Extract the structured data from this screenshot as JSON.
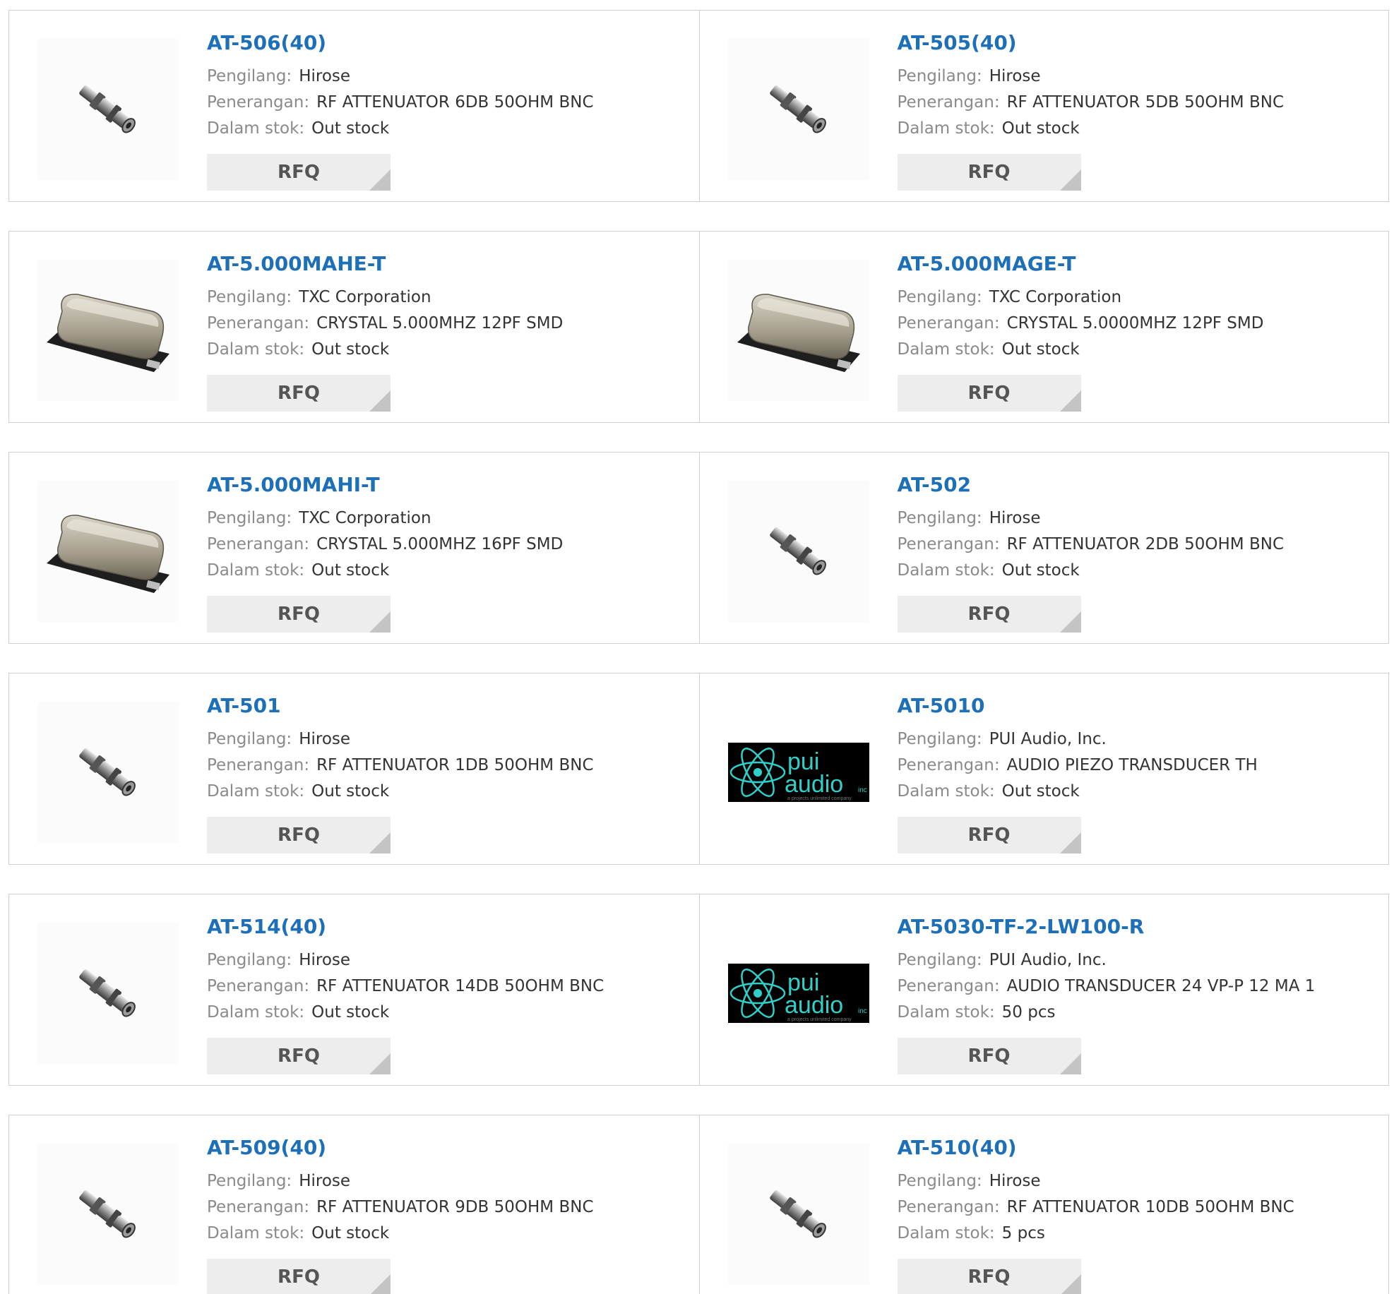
{
  "labels": {
    "manufacturer": "Pengilang:",
    "description": "Penerangan:",
    "stock": "Dalam stok:"
  },
  "colors": {
    "link": "#1d6fb8",
    "label": "#8a8a8a",
    "button_bg": "#ededed",
    "border": "#cfcfcf"
  },
  "products": [
    {
      "part": "AT-506(40)",
      "manufacturer": "Hirose",
      "description": "RF ATTENUATOR 6DB 50OHM BNC",
      "stock": "Out stock",
      "rfq": "RFQ",
      "image": "bnc-attenuator-icon"
    },
    {
      "part": "AT-505(40)",
      "manufacturer": "Hirose",
      "description": "RF ATTENUATOR 5DB 50OHM BNC",
      "stock": "Out stock",
      "rfq": "RFQ",
      "image": "bnc-attenuator-icon"
    },
    {
      "part": "AT-5.000MAHE-T",
      "manufacturer": "TXC Corporation",
      "description": "CRYSTAL 5.000MHZ 12PF SMD",
      "stock": "Out stock",
      "rfq": "RFQ",
      "image": "crystal-smd-icon"
    },
    {
      "part": "AT-5.000MAGE-T",
      "manufacturer": "TXC Corporation",
      "description": "CRYSTAL 5.0000MHZ 12PF SMD",
      "stock": "Out stock",
      "rfq": "RFQ",
      "image": "crystal-smd-icon"
    },
    {
      "part": "AT-5.000MAHI-T",
      "manufacturer": "TXC Corporation",
      "description": "CRYSTAL 5.000MHZ 16PF SMD",
      "stock": "Out stock",
      "rfq": "RFQ",
      "image": "crystal-smd-icon"
    },
    {
      "part": "AT-502",
      "manufacturer": "Hirose",
      "description": "RF ATTENUATOR 2DB 50OHM BNC",
      "stock": "Out stock",
      "rfq": "RFQ",
      "image": "bnc-attenuator-icon"
    },
    {
      "part": "AT-501",
      "manufacturer": "Hirose",
      "description": "RF ATTENUATOR 1DB 50OHM BNC",
      "stock": "Out stock",
      "rfq": "RFQ",
      "image": "bnc-attenuator-icon"
    },
    {
      "part": "AT-5010",
      "manufacturer": "PUI Audio, Inc.",
      "description": "AUDIO PIEZO TRANSDUCER TH",
      "stock": "Out stock",
      "rfq": "RFQ",
      "image": "pui-audio-logo"
    },
    {
      "part": "AT-514(40)",
      "manufacturer": "Hirose",
      "description": "RF ATTENUATOR 14DB 50OHM BNC",
      "stock": "Out stock",
      "rfq": "RFQ",
      "image": "bnc-attenuator-icon"
    },
    {
      "part": "AT-5030-TF-2-LW100-R",
      "manufacturer": "PUI Audio, Inc.",
      "description": "AUDIO TRANSDUCER 24 VP-P 12 MA 1",
      "stock": "50 pcs",
      "rfq": "RFQ",
      "image": "pui-audio-logo"
    },
    {
      "part": "AT-509(40)",
      "manufacturer": "Hirose",
      "description": "RF ATTENUATOR 9DB 50OHM BNC",
      "stock": "Out stock",
      "rfq": "RFQ",
      "image": "bnc-attenuator-icon"
    },
    {
      "part": "AT-510(40)",
      "manufacturer": "Hirose",
      "description": "RF ATTENUATOR 10DB 50OHM BNC",
      "stock": "5 pcs",
      "rfq": "RFQ",
      "image": "bnc-attenuator-icon"
    }
  ],
  "logo_text": {
    "word1": "pui",
    "word2": "audio",
    "suffix": "inc",
    "tagline": "a projects unlimited company"
  }
}
